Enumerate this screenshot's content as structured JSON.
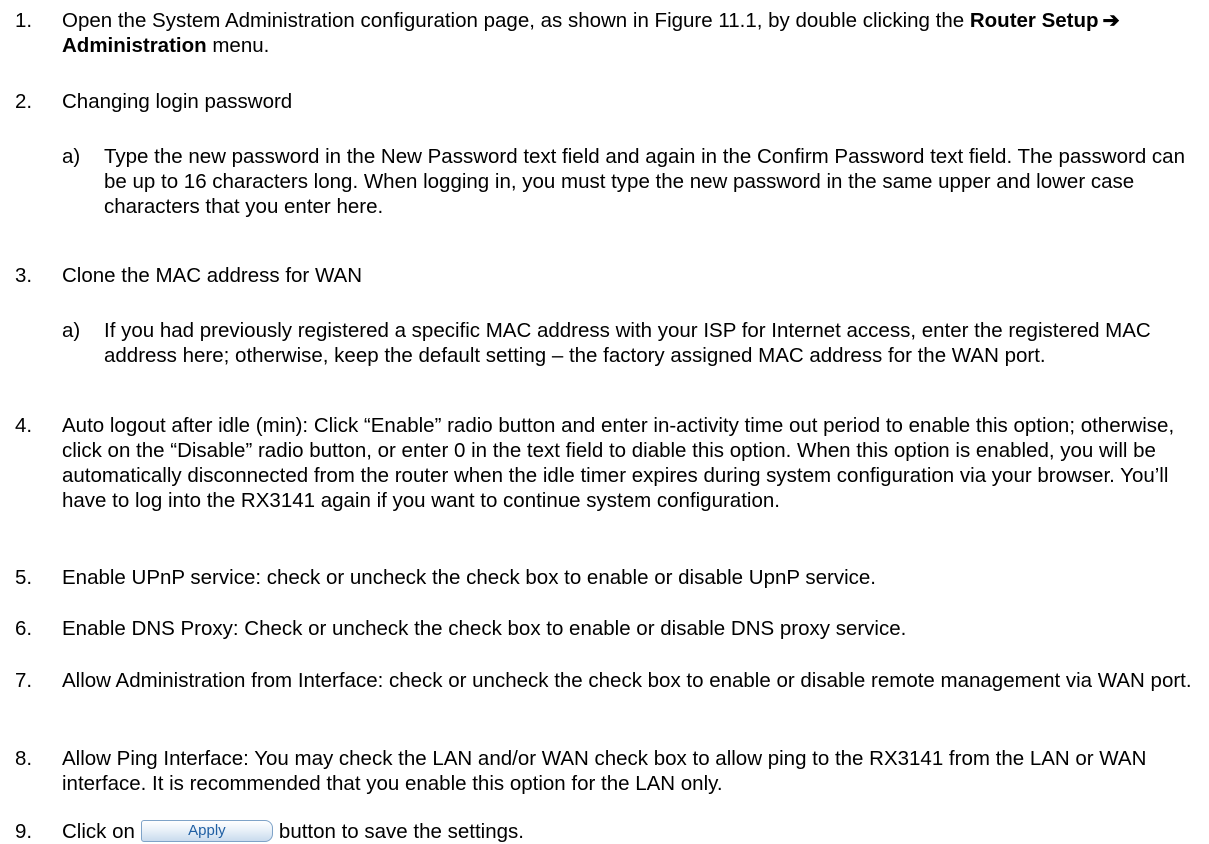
{
  "steps": [
    {
      "num": "1.",
      "text_a": "Open the System Administration configuration page, as shown in Figure 11.1, by double clicking the ",
      "menu_a": "Router Setup",
      "arrow": "➔",
      "menu_b": "Administration",
      "text_b": " menu."
    },
    {
      "num": "2.",
      "text": "Changing login password",
      "sub_letter": "a)",
      "sub_text": "Type the new password in the New Password text field and again in the Confirm Password text field. The password can be up to 16 characters long. When logging in, you must type the new password in the same upper and lower case characters that you enter here."
    },
    {
      "num": "3.",
      "text": "Clone the MAC address for WAN",
      "sub_letter": "a)",
      "sub_text": "If you had previously registered a specific MAC address with your ISP for Internet access, enter the registered MAC address here; otherwise, keep the default setting – the factory assigned MAC address for the WAN port."
    },
    {
      "num": "4.",
      "text": "Auto logout after idle (min): Click “Enable” radio button and enter in-activity time out period to enable this option; otherwise, click on the “Disable” radio button, or enter 0 in the text field to diable this option. When this option is enabled, you will be automatically disconnected from the router when the idle timer expires during system configuration via your browser. You’ll have to log into the RX3141 again if you want to continue system configuration."
    },
    {
      "num": "5.",
      "text": "Enable UPnP service: check or uncheck the check box to enable or disable UpnP service."
    },
    {
      "num": "6.",
      "text": "Enable DNS Proxy: Check or uncheck the check box to enable or disable DNS proxy service."
    },
    {
      "num": "7.",
      "text": "Allow Administration from Interface: check or uncheck the check box to enable or disable remote management via WAN port."
    },
    {
      "num": "8.",
      "text": "Allow Ping Interface: You may check the LAN and/or WAN check box to allow ping to the RX3141 from the LAN or WAN interface. It is recommended that you enable this option for the LAN only."
    },
    {
      "num": "9.",
      "text_a": "Click on",
      "button_label": "Apply",
      "text_b": "button to save the settings."
    }
  ]
}
